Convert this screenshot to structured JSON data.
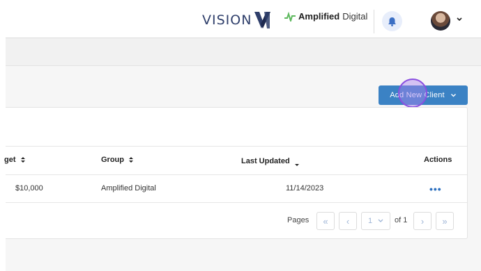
{
  "header": {
    "brand_primary": "VISION",
    "brand_secondary_bold": "Amplified",
    "brand_secondary_light": "Digital",
    "notification_icon": "bell-icon",
    "avatar_icon": "user-avatar",
    "menu_icon": "chevron-down-icon"
  },
  "toolbar": {
    "add_client_label": "Add New Client",
    "add_client_icon": "chevron-down-icon"
  },
  "table": {
    "columns": [
      {
        "label": "get",
        "sort_icon": "sort-both-icon"
      },
      {
        "label": "Group",
        "sort_icon": "sort-both-icon"
      },
      {
        "label": "Last Updated",
        "sort_icon": "sort-desc-icon"
      },
      {
        "label": "Actions"
      }
    ],
    "rows": [
      {
        "budget": "$10,000",
        "group": "Amplified Digital",
        "last_updated": "11/14/2023",
        "actions": "•••"
      }
    ]
  },
  "pagination": {
    "pages_label": "Pages",
    "current_page": "1",
    "of_label": "of",
    "total_pages": "1"
  },
  "colors": {
    "accent": "#3b82c4",
    "brand_navy": "#2f3f6b",
    "pager_icon": "#9db4d6"
  }
}
